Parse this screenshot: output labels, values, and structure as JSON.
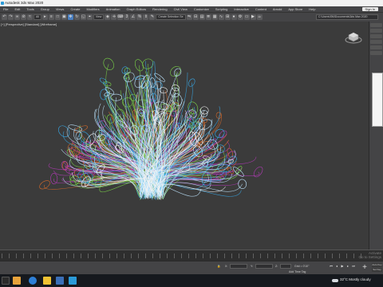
{
  "window": {
    "title": "Autodesk 3ds Max 2020"
  },
  "menu": {
    "items": [
      "File",
      "Edit",
      "Tools",
      "Group",
      "Views",
      "Create",
      "Modifiers",
      "Animation",
      "Graph Editors",
      "Rendering",
      "Civil View",
      "Customize",
      "Scripting",
      "Interactive",
      "Content",
      "Arnold",
      "App Store",
      "Help"
    ],
    "sign_in": "Sign In"
  },
  "toolbar": {
    "selection_filter": "All",
    "view_dropdown": "View",
    "selection_set": "Create Selection Se",
    "path": "C:\\Users\\SM\\Documents\\3ds Max 2020"
  },
  "viewport": {
    "label": "[+] [Perspective] [Standard] [Wireframe]"
  },
  "timeline": {
    "activate_line1": "Activate",
    "activate_line2": "Go to Settings"
  },
  "status": {
    "x_label": "X:",
    "y_label": "Y:",
    "z_label": "Z:",
    "grid": "Grid = 0'10\"",
    "add_time_tag": "Add Time Tag",
    "auto_key": "Auto Key",
    "set_key": "Set Key"
  },
  "taskbar": {
    "weather": "32°C  Mostly cloudy"
  },
  "colors": {
    "viewport_bg": "#3b3b3b",
    "ui_panel": "#444446",
    "accent": "#4a7fc0"
  }
}
